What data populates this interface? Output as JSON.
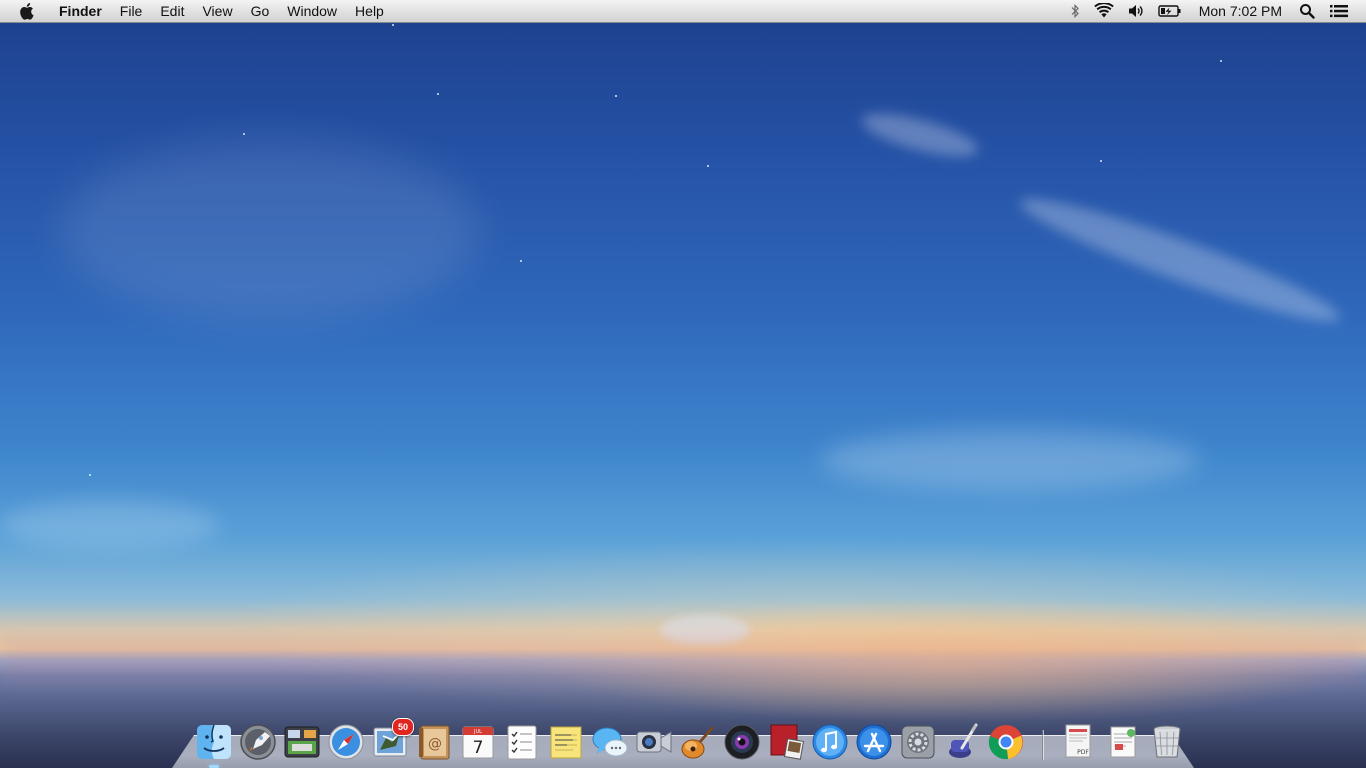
{
  "menubar": {
    "app_name": "Finder",
    "menus": [
      "File",
      "Edit",
      "View",
      "Go",
      "Window",
      "Help"
    ],
    "clock": "Mon 7:02 PM",
    "status_icons": [
      "bluetooth-icon",
      "wifi-icon",
      "volume-icon",
      "battery-charging-icon",
      "spotlight-search-icon",
      "notification-center-icon"
    ]
  },
  "dock": {
    "apps": [
      {
        "name": "Finder",
        "icon": "finder-icon",
        "running": true
      },
      {
        "name": "Launchpad",
        "icon": "launchpad-icon",
        "running": false
      },
      {
        "name": "Mission Control",
        "icon": "mission-control-icon",
        "running": false
      },
      {
        "name": "Safari",
        "icon": "safari-icon",
        "running": false
      },
      {
        "name": "Mail",
        "icon": "mail-icon",
        "running": false,
        "badge": "50"
      },
      {
        "name": "Contacts",
        "icon": "contacts-icon",
        "running": false
      },
      {
        "name": "Calendar",
        "icon": "calendar-icon",
        "running": false,
        "day": "7",
        "month": "JUL"
      },
      {
        "name": "Reminders",
        "icon": "reminders-icon",
        "running": false
      },
      {
        "name": "Notes",
        "icon": "notes-icon",
        "running": false
      },
      {
        "name": "Messages",
        "icon": "messages-icon",
        "running": false
      },
      {
        "name": "FaceTime",
        "icon": "facetime-icon",
        "running": false
      },
      {
        "name": "GarageBand",
        "icon": "garageband-icon",
        "running": false
      },
      {
        "name": "Photo Booth",
        "icon": "photo-booth-icon",
        "running": false
      },
      {
        "name": "iPhoto",
        "icon": "iphoto-icon",
        "running": false
      },
      {
        "name": "iTunes",
        "icon": "itunes-icon",
        "running": false
      },
      {
        "name": "App Store",
        "icon": "app-store-icon",
        "running": false
      },
      {
        "name": "System Preferences",
        "icon": "system-preferences-icon",
        "running": false
      },
      {
        "name": "Script Editor",
        "icon": "quill-icon",
        "running": false
      },
      {
        "name": "Google Chrome",
        "icon": "chrome-icon",
        "running": false
      }
    ],
    "stacks": [
      {
        "name": "Documents",
        "icon": "pdf-document-icon",
        "label": "PDF"
      },
      {
        "name": "Downloads",
        "icon": "document-stack-icon"
      },
      {
        "name": "Trash",
        "icon": "trash-icon"
      }
    ]
  },
  "colors": {
    "menubar_top": "#f4f4f4",
    "menubar_bottom": "#d2d2d2",
    "sky_top": "#1d3f8c",
    "sky_mid": "#3d84cc",
    "horizon_glow": "#e9c7a0",
    "badge_red": "#e0241f"
  }
}
